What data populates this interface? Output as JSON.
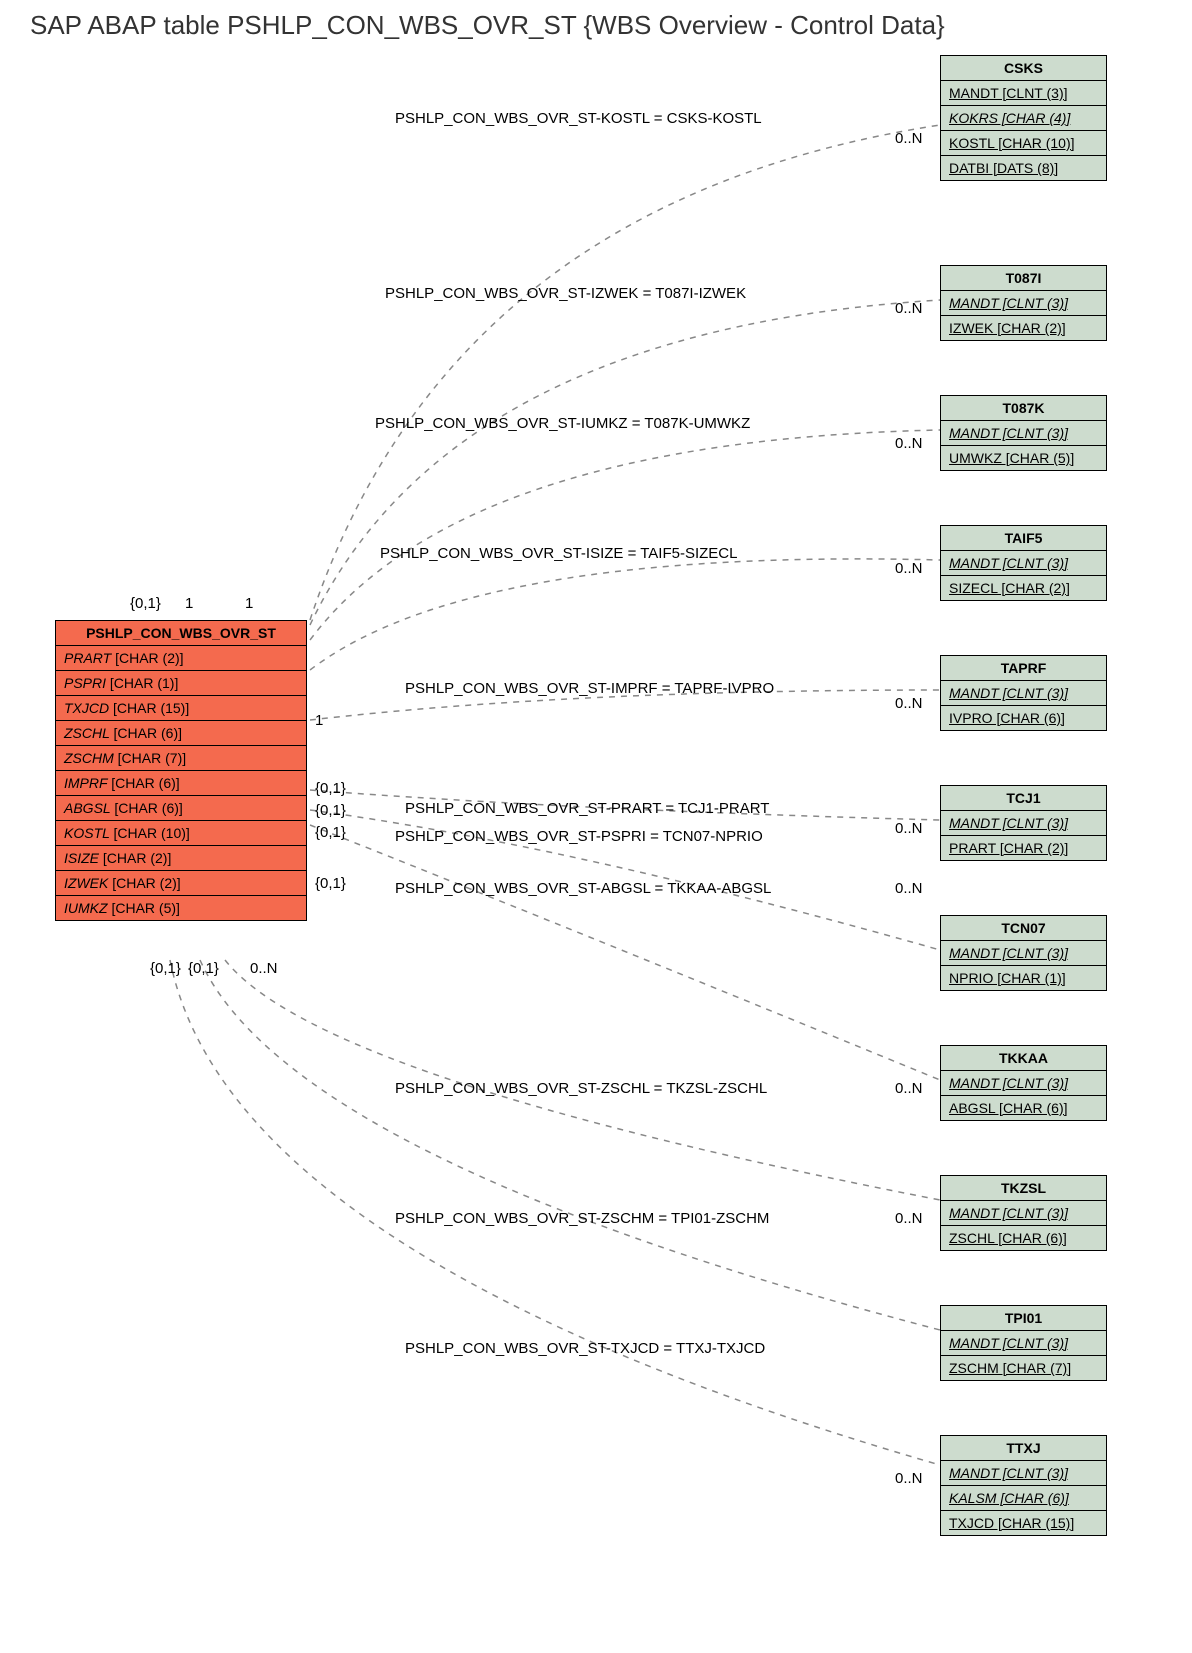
{
  "title": "SAP ABAP table PSHLP_CON_WBS_OVR_ST {WBS Overview - Control Data}",
  "main": {
    "name": "PSHLP_CON_WBS_OVR_ST",
    "fields": [
      {
        "name": "PRART",
        "type": "[CHAR (2)]",
        "italic": true
      },
      {
        "name": "PSPRI",
        "type": "[CHAR (1)]",
        "italic": true
      },
      {
        "name": "TXJCD",
        "type": "[CHAR (15)]",
        "italic": true
      },
      {
        "name": "ZSCHL",
        "type": "[CHAR (6)]",
        "italic": true
      },
      {
        "name": "ZSCHM",
        "type": "[CHAR (7)]",
        "italic": true
      },
      {
        "name": "IMPRF",
        "type": "[CHAR (6)]",
        "italic": true
      },
      {
        "name": "ABGSL",
        "type": "[CHAR (6)]",
        "italic": true
      },
      {
        "name": "KOSTL",
        "type": "[CHAR (10)]",
        "italic": true
      },
      {
        "name": "ISIZE",
        "type": "[CHAR (2)]",
        "italic": true
      },
      {
        "name": "IZWEK",
        "type": "[CHAR (2)]",
        "italic": true
      },
      {
        "name": "IUMKZ",
        "type": "[CHAR (5)]",
        "italic": true
      }
    ]
  },
  "refs": [
    {
      "name": "CSKS",
      "fields": [
        {
          "n": "MANDT",
          "t": "[CLNT (3)]",
          "k": true
        },
        {
          "n": "KOKRS",
          "t": "[CHAR (4)]",
          "k": true,
          "i": true
        },
        {
          "n": "KOSTL",
          "t": "[CHAR (10)]",
          "k": true
        },
        {
          "n": "DATBI",
          "t": "[DATS (8)]",
          "k": true
        }
      ]
    },
    {
      "name": "T087I",
      "fields": [
        {
          "n": "MANDT",
          "t": "[CLNT (3)]",
          "k": true,
          "i": true
        },
        {
          "n": "IZWEK",
          "t": "[CHAR (2)]",
          "k": true
        }
      ]
    },
    {
      "name": "T087K",
      "fields": [
        {
          "n": "MANDT",
          "t": "[CLNT (3)]",
          "k": true,
          "i": true
        },
        {
          "n": "UMWKZ",
          "t": "[CHAR (5)]",
          "k": true
        }
      ]
    },
    {
      "name": "TAIF5",
      "fields": [
        {
          "n": "MANDT",
          "t": "[CLNT (3)]",
          "k": true,
          "i": true
        },
        {
          "n": "SIZECL",
          "t": "[CHAR (2)]",
          "k": true
        }
      ]
    },
    {
      "name": "TAPRF",
      "fields": [
        {
          "n": "MANDT",
          "t": "[CLNT (3)]",
          "k": true,
          "i": true
        },
        {
          "n": "IVPRO",
          "t": "[CHAR (6)]",
          "k": true
        }
      ]
    },
    {
      "name": "TCJ1",
      "fields": [
        {
          "n": "MANDT",
          "t": "[CLNT (3)]",
          "k": true,
          "i": true
        },
        {
          "n": "PRART",
          "t": "[CHAR (2)]",
          "k": true
        }
      ]
    },
    {
      "name": "TCN07",
      "fields": [
        {
          "n": "MANDT",
          "t": "[CLNT (3)]",
          "k": true,
          "i": true
        },
        {
          "n": "NPRIO",
          "t": "[CHAR (1)]",
          "k": true
        }
      ]
    },
    {
      "name": "TKKAA",
      "fields": [
        {
          "n": "MANDT",
          "t": "[CLNT (3)]",
          "k": true,
          "i": true
        },
        {
          "n": "ABGSL",
          "t": "[CHAR (6)]",
          "k": true
        }
      ]
    },
    {
      "name": "TKZSL",
      "fields": [
        {
          "n": "MANDT",
          "t": "[CLNT (3)]",
          "k": true,
          "i": true
        },
        {
          "n": "ZSCHL",
          "t": "[CHAR (6)]",
          "k": true
        }
      ]
    },
    {
      "name": "TPI01",
      "fields": [
        {
          "n": "MANDT",
          "t": "[CLNT (3)]",
          "k": true,
          "i": true
        },
        {
          "n": "ZSCHM",
          "t": "[CHAR (7)]",
          "k": true
        }
      ]
    },
    {
      "name": "TTXJ",
      "fields": [
        {
          "n": "MANDT",
          "t": "[CLNT (3)]",
          "k": true,
          "i": true
        },
        {
          "n": "KALSM",
          "t": "[CHAR (6)]",
          "k": true,
          "i": true
        },
        {
          "n": "TXJCD",
          "t": "[CHAR (15)]",
          "k": true
        }
      ]
    }
  ],
  "relations": [
    {
      "label": "PSHLP_CON_WBS_OVR_ST-KOSTL = CSKS-KOSTL",
      "right": "0..N"
    },
    {
      "label": "PSHLP_CON_WBS_OVR_ST-IZWEK = T087I-IZWEK",
      "right": "0..N"
    },
    {
      "label": "PSHLP_CON_WBS_OVR_ST-IUMKZ = T087K-UMWKZ",
      "right": "0..N"
    },
    {
      "label": "PSHLP_CON_WBS_OVR_ST-ISIZE = TAIF5-SIZECL",
      "right": "0..N"
    },
    {
      "label": "PSHLP_CON_WBS_OVR_ST-IMPRF = TAPRF-IVPRO",
      "right": "0..N"
    },
    {
      "label": "PSHLP_CON_WBS_OVR_ST-PRART = TCJ1-PRART",
      "right": "0..N"
    },
    {
      "label": "PSHLP_CON_WBS_OVR_ST-PSPRI = TCN07-NPRIO",
      "right": ""
    },
    {
      "label": "PSHLP_CON_WBS_OVR_ST-ABGSL = TKKAA-ABGSL",
      "right": "0..N"
    },
    {
      "label": "PSHLP_CON_WBS_OVR_ST-ZSCHL = TKZSL-ZSCHL",
      "right": "0..N"
    },
    {
      "label": "PSHLP_CON_WBS_OVR_ST-ZSCHM = TPI01-ZSCHM",
      "right": "0..N"
    },
    {
      "label": "PSHLP_CON_WBS_OVR_ST-TXJCD = TTXJ-TXJCD",
      "right": "0..N"
    }
  ],
  "leftCards": [
    "{0,1}",
    "1",
    "1",
    "1",
    "{0,1}",
    "{0,1}",
    "{0,1}",
    "{0,1}",
    "{0,1}",
    "{0,1}",
    "0..N"
  ]
}
